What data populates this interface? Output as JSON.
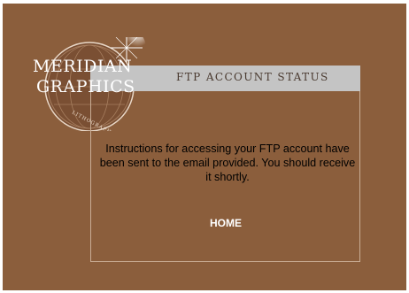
{
  "brand": {
    "line1": "MERIDIAN",
    "line2": "GRAPHICS",
    "tagline": "LITHOGRAPHY"
  },
  "header": {
    "title": "FTP ACCOUNT STATUS"
  },
  "main": {
    "message": "Instructions for accessing your FTP account have been sent to the email provided. You should receive it shortly.",
    "home_link": "HOME"
  },
  "colors": {
    "background": "#8b5e3c",
    "header_bar": "#c4c4c4",
    "panel_border": "#c9ad95"
  }
}
